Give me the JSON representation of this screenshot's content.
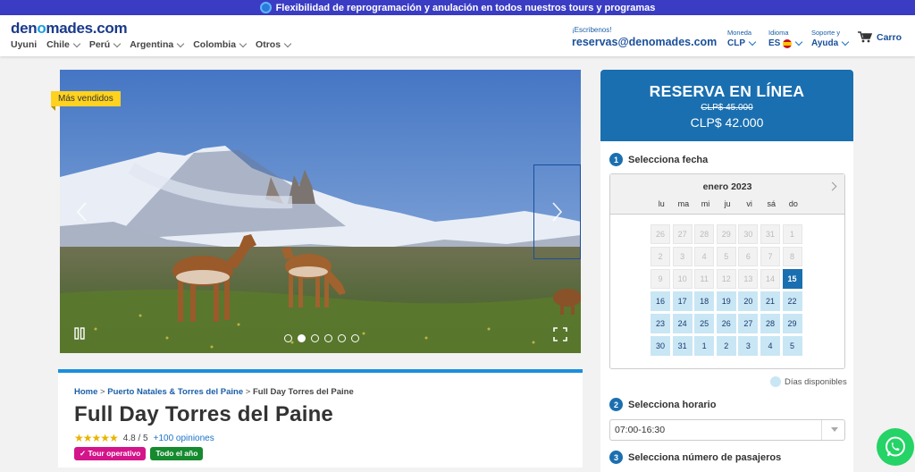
{
  "promo": {
    "text": "Flexibilidad de reprogramación y anulación en todos nuestros tours y programas"
  },
  "header": {
    "logo_pre": "den",
    "logo_o": "o",
    "logo_post": "mades.com",
    "nav": [
      "Uyuni",
      "Chile",
      "Perú",
      "Argentina",
      "Colombia",
      "Otros"
    ],
    "contact_label": "¡Escribenos!",
    "contact_email": "reservas@denomades.com",
    "currency_label": "Moneda",
    "currency_value": "CLP",
    "language_label": "Idioma",
    "language_value": "ES",
    "support_label": "Soporte y",
    "support_value": "Ayuda",
    "cart_label": "Carro"
  },
  "gallery": {
    "badge": "Más vendidos",
    "slide_count": 6,
    "active_slide": 1
  },
  "product": {
    "breadcrumb": {
      "home": "Home",
      "sep": ">",
      "parent": "Puerto Natales & Torres del Paine",
      "current": "Full Day Torres del Paine"
    },
    "title": "Full Day Torres del Paine",
    "stars": "★★★★★",
    "rating": "4.8 / 5",
    "reviews": "+100 opiniones",
    "tags": [
      "✓ Tour operativo",
      "Todo el año"
    ]
  },
  "booking": {
    "title": "RESERVA EN LÍNEA",
    "old_price": "CLP$ 45.000",
    "new_price": "CLP$ 42.000",
    "step1_num": "1",
    "step1": "Selecciona fecha",
    "month": "enero 2023",
    "weekdays": [
      "lu",
      "ma",
      "mi",
      "ju",
      "vi",
      "sá",
      "do"
    ],
    "days": [
      {
        "n": "26",
        "s": "dis"
      },
      {
        "n": "27",
        "s": "dis"
      },
      {
        "n": "28",
        "s": "dis"
      },
      {
        "n": "29",
        "s": "dis"
      },
      {
        "n": "30",
        "s": "dis"
      },
      {
        "n": "31",
        "s": "dis"
      },
      {
        "n": "1",
        "s": "dis"
      },
      {
        "n": "2",
        "s": "dis"
      },
      {
        "n": "3",
        "s": "dis"
      },
      {
        "n": "4",
        "s": "dis"
      },
      {
        "n": "5",
        "s": "dis"
      },
      {
        "n": "6",
        "s": "dis"
      },
      {
        "n": "7",
        "s": "dis"
      },
      {
        "n": "8",
        "s": "dis"
      },
      {
        "n": "9",
        "s": "dis"
      },
      {
        "n": "10",
        "s": "dis"
      },
      {
        "n": "11",
        "s": "dis"
      },
      {
        "n": "12",
        "s": "dis"
      },
      {
        "n": "13",
        "s": "dis"
      },
      {
        "n": "14",
        "s": "dis"
      },
      {
        "n": "15",
        "s": "sel"
      },
      {
        "n": "16",
        "s": "av"
      },
      {
        "n": "17",
        "s": "av"
      },
      {
        "n": "18",
        "s": "av"
      },
      {
        "n": "19",
        "s": "av"
      },
      {
        "n": "20",
        "s": "av"
      },
      {
        "n": "21",
        "s": "av"
      },
      {
        "n": "22",
        "s": "av"
      },
      {
        "n": "23",
        "s": "av"
      },
      {
        "n": "24",
        "s": "av"
      },
      {
        "n": "25",
        "s": "av"
      },
      {
        "n": "26",
        "s": "av"
      },
      {
        "n": "27",
        "s": "av"
      },
      {
        "n": "28",
        "s": "av"
      },
      {
        "n": "29",
        "s": "av"
      },
      {
        "n": "30",
        "s": "av"
      },
      {
        "n": "31",
        "s": "av"
      },
      {
        "n": "1",
        "s": "av"
      },
      {
        "n": "2",
        "s": "av"
      },
      {
        "n": "3",
        "s": "av"
      },
      {
        "n": "4",
        "s": "av"
      },
      {
        "n": "5",
        "s": "av"
      }
    ],
    "legend": "Días disponibles",
    "step2_num": "2",
    "step2": "Selecciona horario",
    "time_value": "07:00-16:30",
    "step3_num": "3",
    "step3": "Selecciona número de pasajeros"
  },
  "colors": {
    "brand": "#1a6fb0",
    "promo": "#3b3cc4",
    "available": "#c9e6f5",
    "badge": "#ffd21f",
    "whatsapp": "#25d366"
  }
}
